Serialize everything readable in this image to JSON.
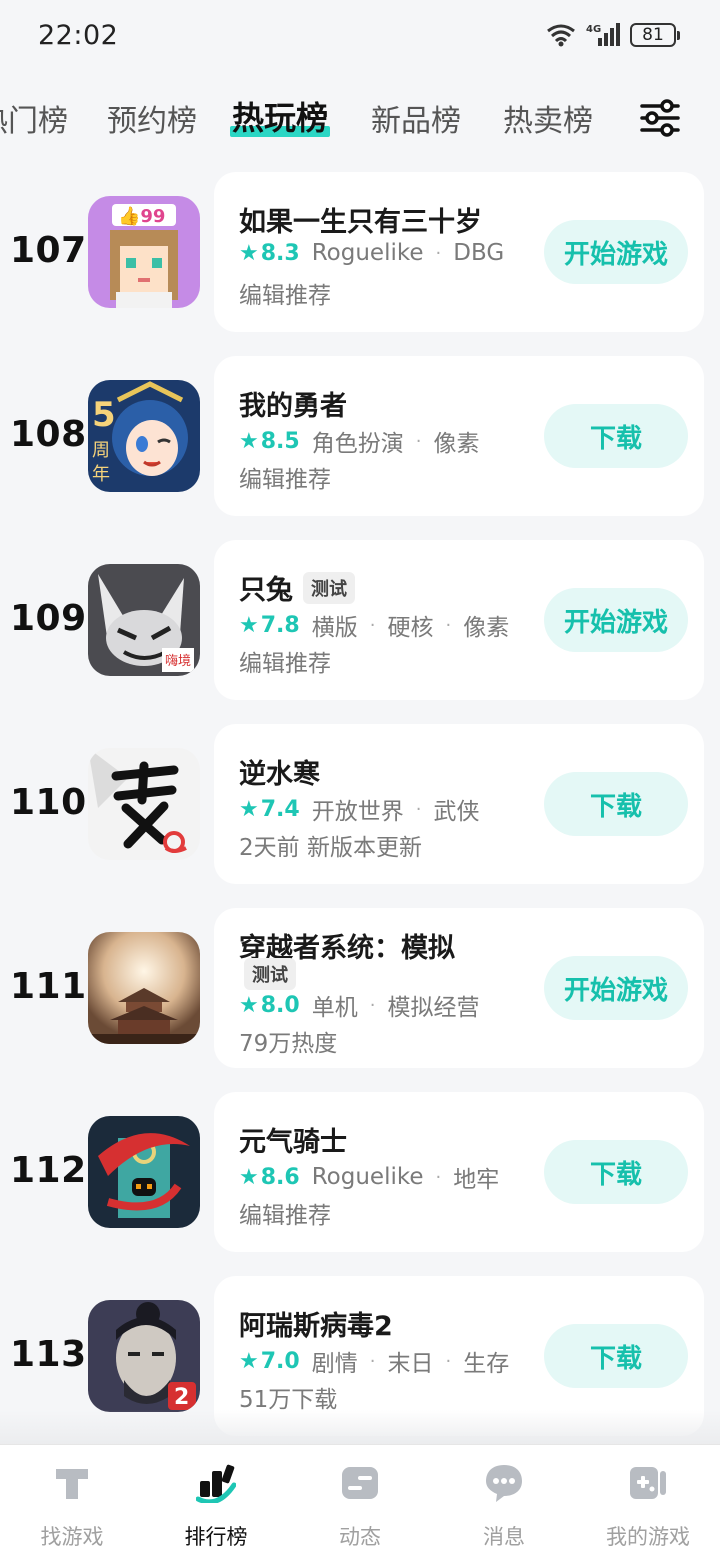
{
  "status_bar": {
    "time": "22:02",
    "network": "4G",
    "battery": "81"
  },
  "tabs": [
    {
      "label": "热门榜",
      "active": false
    },
    {
      "label": "预约榜",
      "active": false
    },
    {
      "label": "热玩榜",
      "active": true
    },
    {
      "label": "新品榜",
      "active": false
    },
    {
      "label": "热卖榜",
      "active": false
    }
  ],
  "games": [
    {
      "rank": "107",
      "title": "如果一生只有三十岁",
      "badge": "",
      "score": "8.3",
      "tags": [
        "Roguelike",
        "DBG"
      ],
      "sub": "编辑推荐",
      "action": "开始游戏",
      "icon": "pixel-girl-icon",
      "icon_color": "#c58be6"
    },
    {
      "rank": "108",
      "title": "我的勇者",
      "badge": "",
      "score": "8.5",
      "tags": [
        "角色扮演",
        "像素"
      ],
      "sub": "编辑推荐",
      "action": "下载",
      "icon": "anime-hero-icon",
      "icon_color": "#1c3a6b"
    },
    {
      "rank": "109",
      "title": "只兔",
      "badge": "测试",
      "score": "7.8",
      "tags": [
        "横版",
        "硬核",
        "像素"
      ],
      "sub": "编辑推荐",
      "action": "开始游戏",
      "icon": "rabbit-icon",
      "icon_color": "#4b4b50"
    },
    {
      "rank": "110",
      "title": "逆水寒",
      "badge": "",
      "score": "7.4",
      "tags": [
        "开放世界",
        "武侠"
      ],
      "sub": "2天前 新版本更新",
      "action": "下载",
      "icon": "calligraphy-icon",
      "icon_color": "#f3f3f3"
    },
    {
      "rank": "111",
      "title": "穿越者系统：模拟",
      "badge": "测试",
      "score": "8.0",
      "tags": [
        "单机",
        "模拟经营"
      ],
      "sub": "79万热度",
      "action": "开始游戏",
      "icon": "pagoda-icon",
      "icon_color": "#8a6a4f"
    },
    {
      "rank": "112",
      "title": "元气骑士",
      "badge": "",
      "score": "8.6",
      "tags": [
        "Roguelike",
        "地牢"
      ],
      "sub": "编辑推荐",
      "action": "下载",
      "icon": "knight-icon",
      "icon_color": "#1b2a3a"
    },
    {
      "rank": "113",
      "title": "阿瑞斯病毒2",
      "badge": "",
      "score": "7.0",
      "tags": [
        "剧情",
        "末日",
        "生存"
      ],
      "sub": "51万下载",
      "action": "下载",
      "icon": "survivor-icon",
      "icon_color": "#3d3d55"
    }
  ],
  "bottom_nav": [
    {
      "label": "找游戏",
      "icon": "find-game-icon",
      "active": false
    },
    {
      "label": "排行榜",
      "icon": "ranking-icon",
      "active": true
    },
    {
      "label": "动态",
      "icon": "feed-icon",
      "active": false
    },
    {
      "label": "消息",
      "icon": "message-icon",
      "active": false
    },
    {
      "label": "我的游戏",
      "icon": "my-games-icon",
      "active": false
    }
  ],
  "colors": {
    "accent": "#1ec6b4",
    "button_bg": "#e4f8f6",
    "tab_highlight": "#2bd6c4"
  }
}
